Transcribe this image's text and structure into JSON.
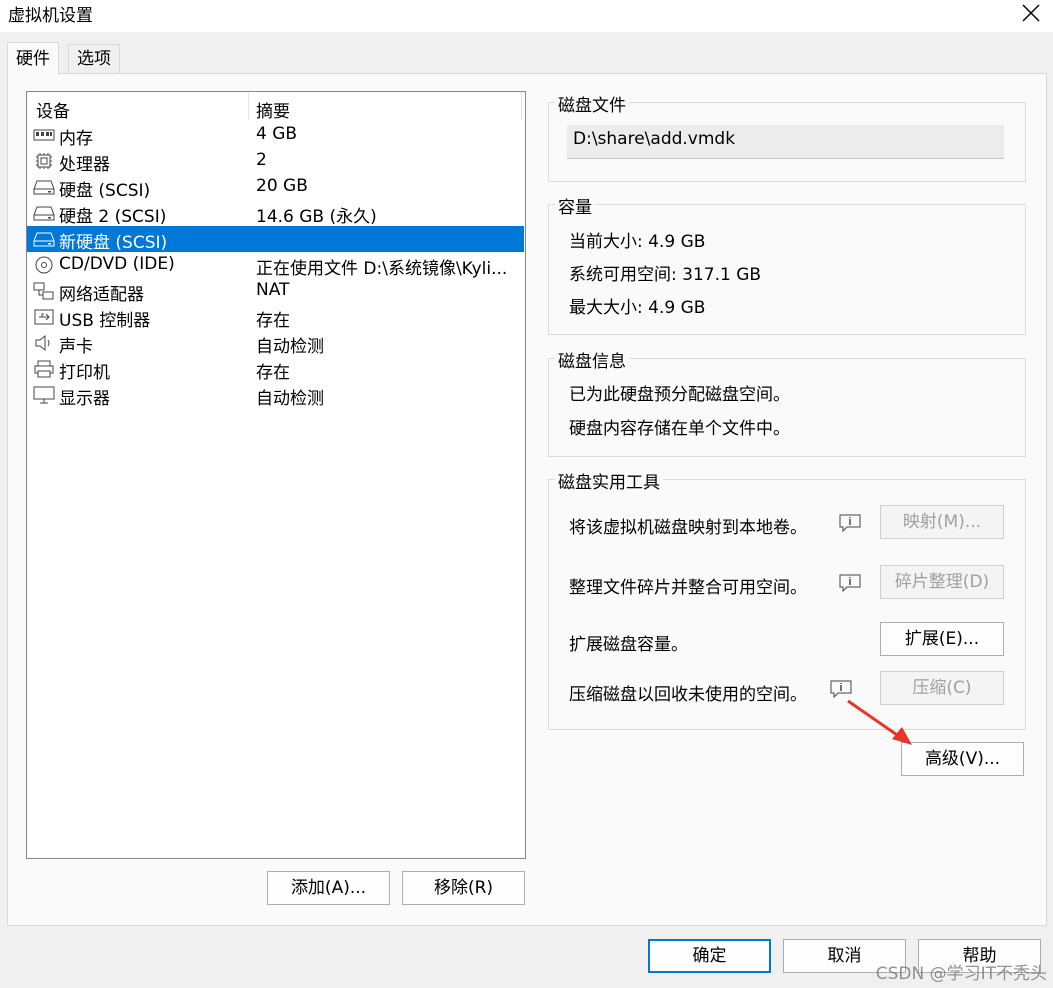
{
  "window": {
    "title": "虚拟机设置"
  },
  "tabs": [
    {
      "label": "硬件"
    },
    {
      "label": "选项"
    }
  ],
  "device_list": {
    "headers": {
      "device": "设备",
      "summary": "摘要"
    },
    "rows": [
      {
        "name": "内存",
        "summary": "4 GB",
        "icon": "memory-icon"
      },
      {
        "name": "处理器",
        "summary": "2",
        "icon": "processor-icon"
      },
      {
        "name": "硬盘 (SCSI)",
        "summary": "20 GB",
        "icon": "harddisk-icon"
      },
      {
        "name": "硬盘 2 (SCSI)",
        "summary": "14.6 GB (永久)",
        "icon": "harddisk-icon"
      },
      {
        "name": "新硬盘 (SCSI)",
        "summary": "",
        "icon": "harddisk-icon",
        "selected": true
      },
      {
        "name": "CD/DVD (IDE)",
        "summary": "正在使用文件 D:\\系统镜像\\Kyli...",
        "icon": "cd-dvd-icon"
      },
      {
        "name": "网络适配器",
        "summary": "NAT",
        "icon": "network-adapter-icon"
      },
      {
        "name": "USB 控制器",
        "summary": "存在",
        "icon": "usb-icon"
      },
      {
        "name": "声卡",
        "summary": "自动检测",
        "icon": "sound-card-icon"
      },
      {
        "name": "打印机",
        "summary": "存在",
        "icon": "printer-icon"
      },
      {
        "name": "显示器",
        "summary": "自动检测",
        "icon": "display-icon"
      }
    ]
  },
  "list_buttons": {
    "add": "添加(A)...",
    "remove": "移除(R)"
  },
  "disk_file": {
    "label": "磁盘文件",
    "path": "D:\\share\\add.vmdk"
  },
  "capacity": {
    "label": "容量",
    "current_size": "当前大小: 4.9 GB",
    "available_space": "系统可用空间: 317.1 GB",
    "max_size": "最大大小: 4.9 GB"
  },
  "disk_info": {
    "label": "磁盘信息",
    "line1": "已为此硬盘预分配磁盘空间。",
    "line2": "硬盘内容存储在单个文件中。"
  },
  "disk_utilities": {
    "label": "磁盘实用工具",
    "map_text": "将该虚拟机磁盘映射到本地卷。",
    "map_button": "映射(M)...",
    "defrag_text": "整理文件碎片并整合可用空间。",
    "defrag_button": "碎片整理(D)",
    "expand_text": "扩展磁盘容量。",
    "expand_button": "扩展(E)...",
    "compact_text": "压缩磁盘以回收未使用的空间。",
    "compact_button": "压缩(C)"
  },
  "advanced_button": "高级(V)...",
  "footer": {
    "ok": "确定",
    "cancel": "取消",
    "help": "帮助"
  },
  "watermark": "CSDN @学习IT不秃头",
  "colors": {
    "selection": "#0078d7",
    "annotation_arrow": "#e8352a"
  }
}
